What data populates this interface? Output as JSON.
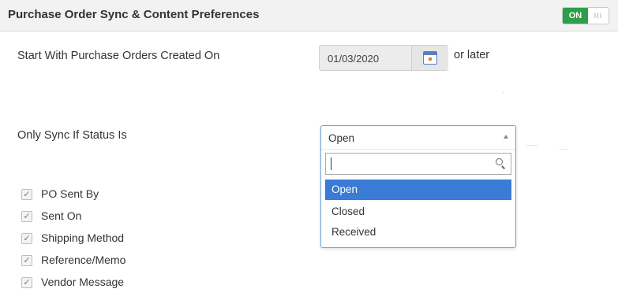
{
  "header": {
    "title": "Purchase Order Sync & Content Preferences",
    "toggle": {
      "state_label": "ON",
      "grip": "III",
      "accent": "#2e9e4a"
    }
  },
  "start_date": {
    "label": "Start With Purchase Orders Created On",
    "value": "01/03/2020",
    "calendar_icon": "calendar-icon",
    "suffix": "or later"
  },
  "status_filter": {
    "label": "Only Sync If Status Is",
    "selected": "Open",
    "search_value": "",
    "options": [
      "Open",
      "Closed",
      "Received"
    ],
    "highlight_color": "#3a7bd5"
  },
  "content_checkboxes": [
    {
      "label": "PO Sent By",
      "checked": true
    },
    {
      "label": "Sent On",
      "checked": true
    },
    {
      "label": "Shipping Method",
      "checked": true
    },
    {
      "label": "Reference/Memo",
      "checked": true
    },
    {
      "label": "Vendor Message",
      "checked": true
    }
  ]
}
